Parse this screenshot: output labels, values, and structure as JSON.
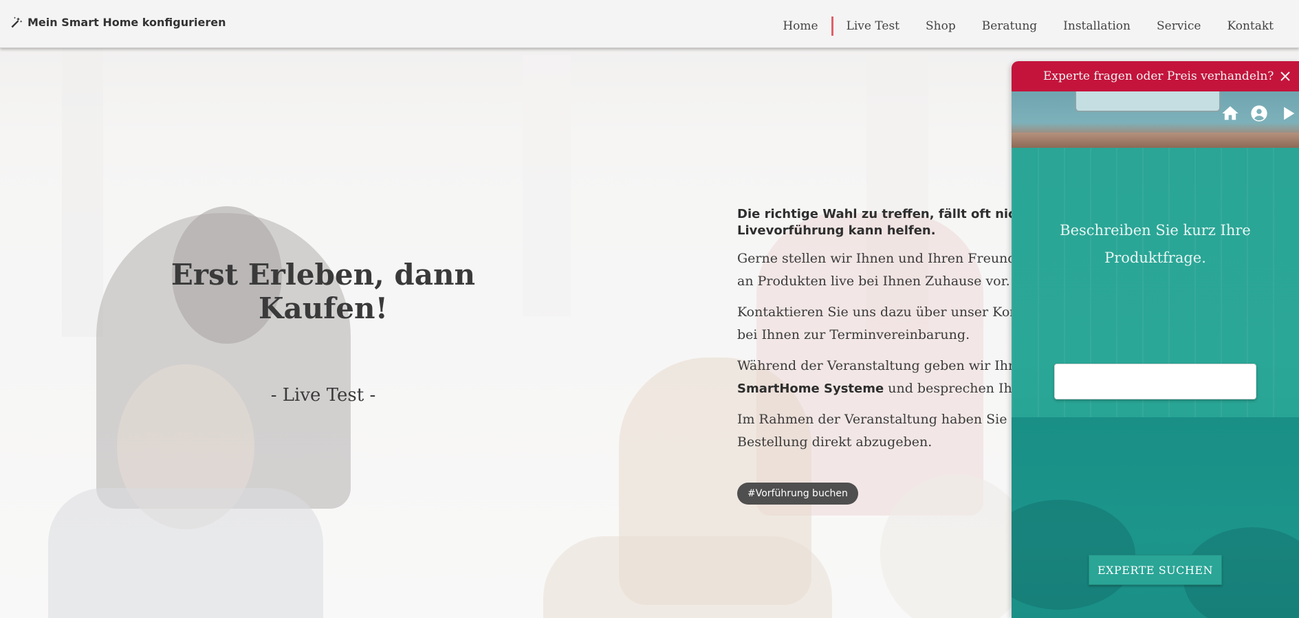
{
  "header": {
    "brand_icon": "magic-wand-icon",
    "brand_label": "Mein Smart Home konfigurieren",
    "nav": [
      {
        "label": "Home"
      },
      {
        "label": "Live Test"
      },
      {
        "label": "Shop"
      },
      {
        "label": "Beratung"
      },
      {
        "label": "Installation"
      },
      {
        "label": "Service"
      },
      {
        "label": "Kontakt"
      }
    ],
    "active_separator_color": "#e0606a"
  },
  "hero": {
    "title": "Erst Erleben, dann Kaufen!",
    "subtitle": "- Live Test -",
    "lead": [
      "Die richtige Wahl zu treffen, fällt oft nicht",
      "Livevorführung kann helfen."
    ],
    "paragraphs": [
      {
        "lines": [
          "Gerne stellen wir Ihnen und Ihren Freunde",
          "an Produkten live bei Ihnen Zuhause vor."
        ]
      },
      {
        "lines": [
          "Kontaktieren Sie uns dazu über unser Kon",
          "bei Ihnen zur Terminvereinbarung."
        ]
      },
      {
        "line1": "Während der Veranstaltung geben wir Ihne",
        "bold": "SmartHome Systeme",
        "rest": " und besprechen Ihre"
      },
      {
        "lines": [
          "Im Rahmen der Veranstaltung haben Sie na",
          "Bestellung direkt abzugeben."
        ]
      }
    ],
    "cta": "#Vorführung buchen"
  },
  "widget": {
    "title": "Experte fragen oder Preis verhandeln?",
    "header_color": "#c4143c",
    "accent_color": "#2aa596",
    "icons": [
      "home-icon",
      "account-circle-icon",
      "play-icon"
    ],
    "question": "Beschreiben Sie kurz Ihre Produktfrage.",
    "input_value": "",
    "button": "EXPERTE SUCHEN"
  }
}
